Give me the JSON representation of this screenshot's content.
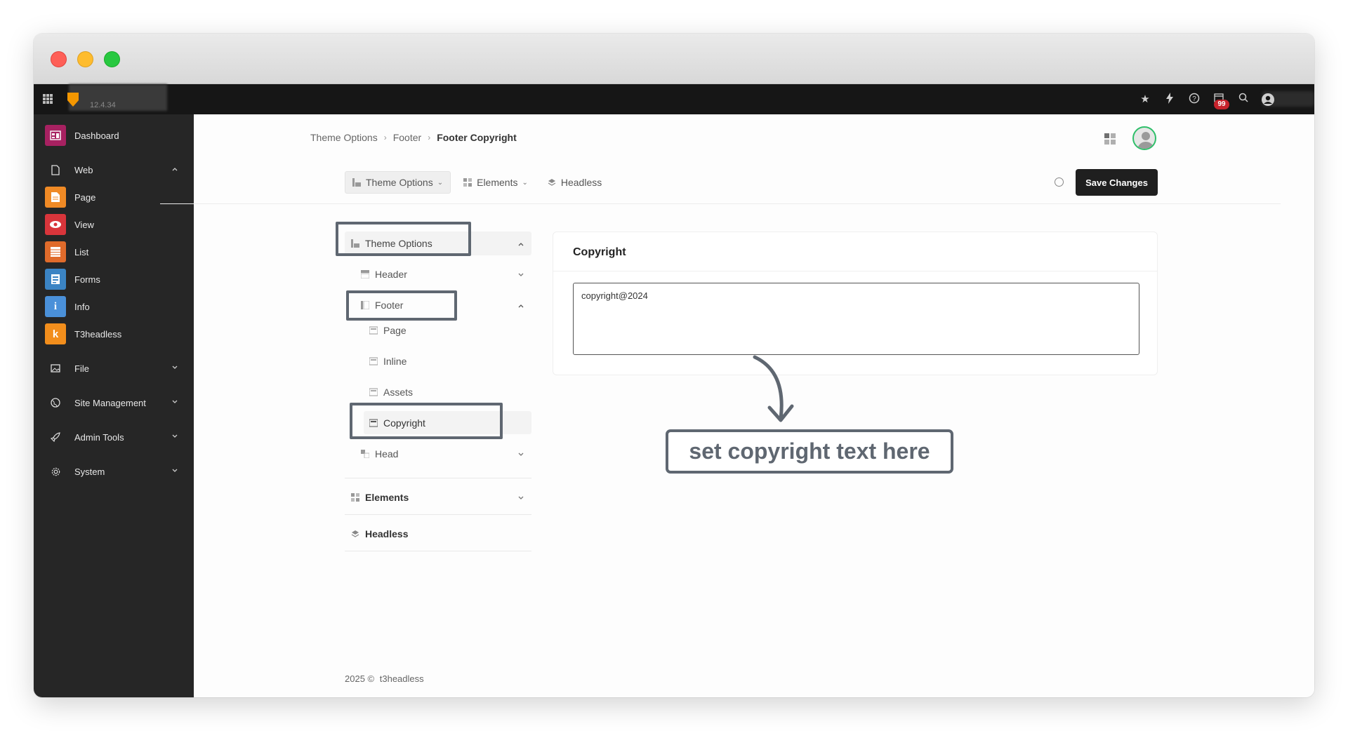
{
  "topbar": {
    "version": "12.4.34",
    "notification_count": "99",
    "icons": [
      "apps-grid-icon",
      "star-icon",
      "bolt-icon",
      "help-icon",
      "calendar-icon",
      "search-icon",
      "user-icon"
    ]
  },
  "sidebar": {
    "items": [
      {
        "label": "Dashboard",
        "type": "module",
        "color": "#a72161",
        "icon": "dashboard-icon"
      },
      {
        "label": "Web",
        "type": "group",
        "icon": "page-outline-icon",
        "expanded": true
      },
      {
        "label": "Page",
        "type": "module",
        "color": "#f08a25",
        "icon": "page-icon"
      },
      {
        "label": "View",
        "type": "module",
        "color": "#d9353b",
        "icon": "eye-icon"
      },
      {
        "label": "List",
        "type": "module",
        "color": "#e06b2b",
        "icon": "list-icon"
      },
      {
        "label": "Forms",
        "type": "module",
        "color": "#3b84c4",
        "icon": "forms-icon"
      },
      {
        "label": "Info",
        "type": "module",
        "color": "#4a90d9",
        "icon": "info-icon"
      },
      {
        "label": "T3headless",
        "type": "module",
        "color": "#f28e1c",
        "icon": "t3headless-icon"
      },
      {
        "label": "File",
        "type": "group",
        "icon": "image-icon",
        "expanded": false
      },
      {
        "label": "Site Management",
        "type": "group",
        "icon": "globe-icon",
        "expanded": false
      },
      {
        "label": "Admin Tools",
        "type": "group",
        "icon": "rocket-icon",
        "expanded": false
      },
      {
        "label": "System",
        "type": "group",
        "icon": "gear-icon",
        "expanded": false
      }
    ]
  },
  "breadcrumb": [
    "Theme Options",
    "Footer",
    "Footer Copyright"
  ],
  "toolbar": {
    "theme_options": "Theme Options",
    "elements": "Elements",
    "headless": "Headless",
    "save": "Save Changes"
  },
  "tree": {
    "theme_options": "Theme Options",
    "header": "Header",
    "footer": "Footer",
    "footer_children": [
      "Page",
      "Inline",
      "Assets",
      "Copyright"
    ],
    "head": "Head",
    "elements": "Elements",
    "headless": "Headless"
  },
  "card": {
    "title": "Copyright",
    "value": "copyright@2024"
  },
  "annotation": "set copyright text here",
  "footer": {
    "year": "2025 ©",
    "brand": "t3headless"
  }
}
